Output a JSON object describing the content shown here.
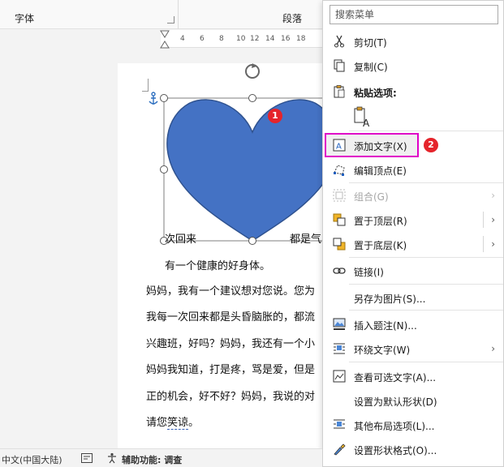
{
  "ribbon": {
    "group_font": "字体",
    "group_paragraph": "段落"
  },
  "ruler": {
    "ticks": [
      "4",
      "6",
      "8",
      "10",
      "12",
      "14",
      "16",
      "18"
    ]
  },
  "document": {
    "label_left": "次回来",
    "label_right": "都是气",
    "line1": "有一个健康的好身体。",
    "line2": "妈妈，我有一个建议想对您说。您为",
    "line3": "我每一次回来都是头昏脑胀的，都流",
    "line4": "兴趣班，好吗？妈妈，我还有一个小",
    "line5": "妈妈我知道，打是疼，骂是爱，但是",
    "line6": "正的机会，好不好？妈妈，我说的对",
    "line7a": "请您",
    "line7b": "笑谅",
    "line7c": "。"
  },
  "shape": {
    "fill": "#4472C4",
    "stroke": "#2F528F",
    "name": "heart-shape"
  },
  "badges": {
    "one": "1",
    "two": "2"
  },
  "menu": {
    "search_placeholder": "搜索菜单",
    "cut": "剪切(T)",
    "copy": "复制(C)",
    "paste_options": "粘贴选项:",
    "add_text": "添加文字(X)",
    "edit_points": "编辑顶点(E)",
    "group": "组合(G)",
    "bring_front": "置于顶层(R)",
    "send_back": "置于底层(K)",
    "link": "链接(I)",
    "save_as_picture": "另存为图片(S)...",
    "insert_caption": "插入题注(N)...",
    "wrap_text": "环绕文字(W)",
    "view_alt_text": "查看可选文字(A)...",
    "set_default_shape": "设置为默认形状(D)",
    "more_layout": "其他布局选项(L)...",
    "format_shape": "设置形状格式(O)..."
  },
  "status": {
    "language": "中文(中国大陆)",
    "accessibility": "辅助功能: 调查"
  },
  "colors": {
    "accent": "#4472C4",
    "highlight_border": "#e000c8",
    "badge": "#e5242b"
  }
}
